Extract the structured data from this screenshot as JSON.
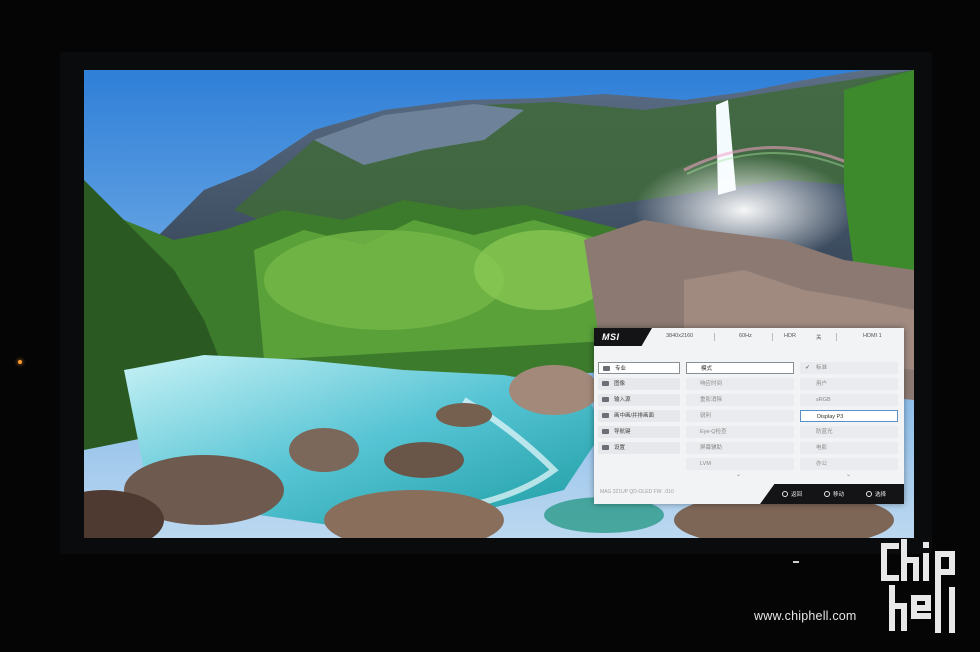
{
  "osd": {
    "brand": "MSI",
    "status": {
      "resolution": "3840x2160",
      "refresh": "60Hz",
      "hdr": "HDR",
      "hdr_state": "关",
      "input": "HDMI 1"
    },
    "categories": [
      {
        "label": "专业",
        "icon": "professional-icon",
        "selected": true
      },
      {
        "label": "图像",
        "icon": "image-icon",
        "selected": false
      },
      {
        "label": "输入源",
        "icon": "input-source-icon",
        "selected": false
      },
      {
        "label": "画中画/并排画面",
        "icon": "pip-icon",
        "selected": false
      },
      {
        "label": "导航键",
        "icon": "navi-key-icon",
        "selected": false
      },
      {
        "label": "设置",
        "icon": "settings-icon",
        "selected": false
      }
    ],
    "submenu": [
      {
        "label": "模式",
        "selected": true
      },
      {
        "label": "响应时间",
        "selected": false
      },
      {
        "label": "重影消除",
        "selected": false
      },
      {
        "label": "锐利",
        "selected": false
      },
      {
        "label": "Eye-Q检查",
        "selected": false
      },
      {
        "label": "屏幕辅助",
        "selected": false
      },
      {
        "label": "LVM",
        "selected": false
      }
    ],
    "options": [
      {
        "label": "标准",
        "checked": true,
        "selected": false
      },
      {
        "label": "用户",
        "checked": false,
        "selected": false
      },
      {
        "label": "sRGB",
        "checked": false,
        "selected": false
      },
      {
        "label": "Display P3",
        "checked": false,
        "selected": true
      },
      {
        "label": "防蓝光",
        "checked": false,
        "selected": false
      },
      {
        "label": "电影",
        "checked": false,
        "selected": false
      },
      {
        "label": "办公",
        "checked": false,
        "selected": false
      }
    ],
    "model": "MAG 321UP QD-OLED  FW: .010",
    "controls": [
      {
        "label": "返回",
        "icon": "back-button-icon"
      },
      {
        "label": "移动",
        "icon": "move-button-icon"
      },
      {
        "label": "选择",
        "icon": "select-button-icon"
      }
    ],
    "more_indicator": "⌄"
  },
  "watermark": {
    "url": "www.chiphell.com",
    "logo_text": "chip hell"
  }
}
